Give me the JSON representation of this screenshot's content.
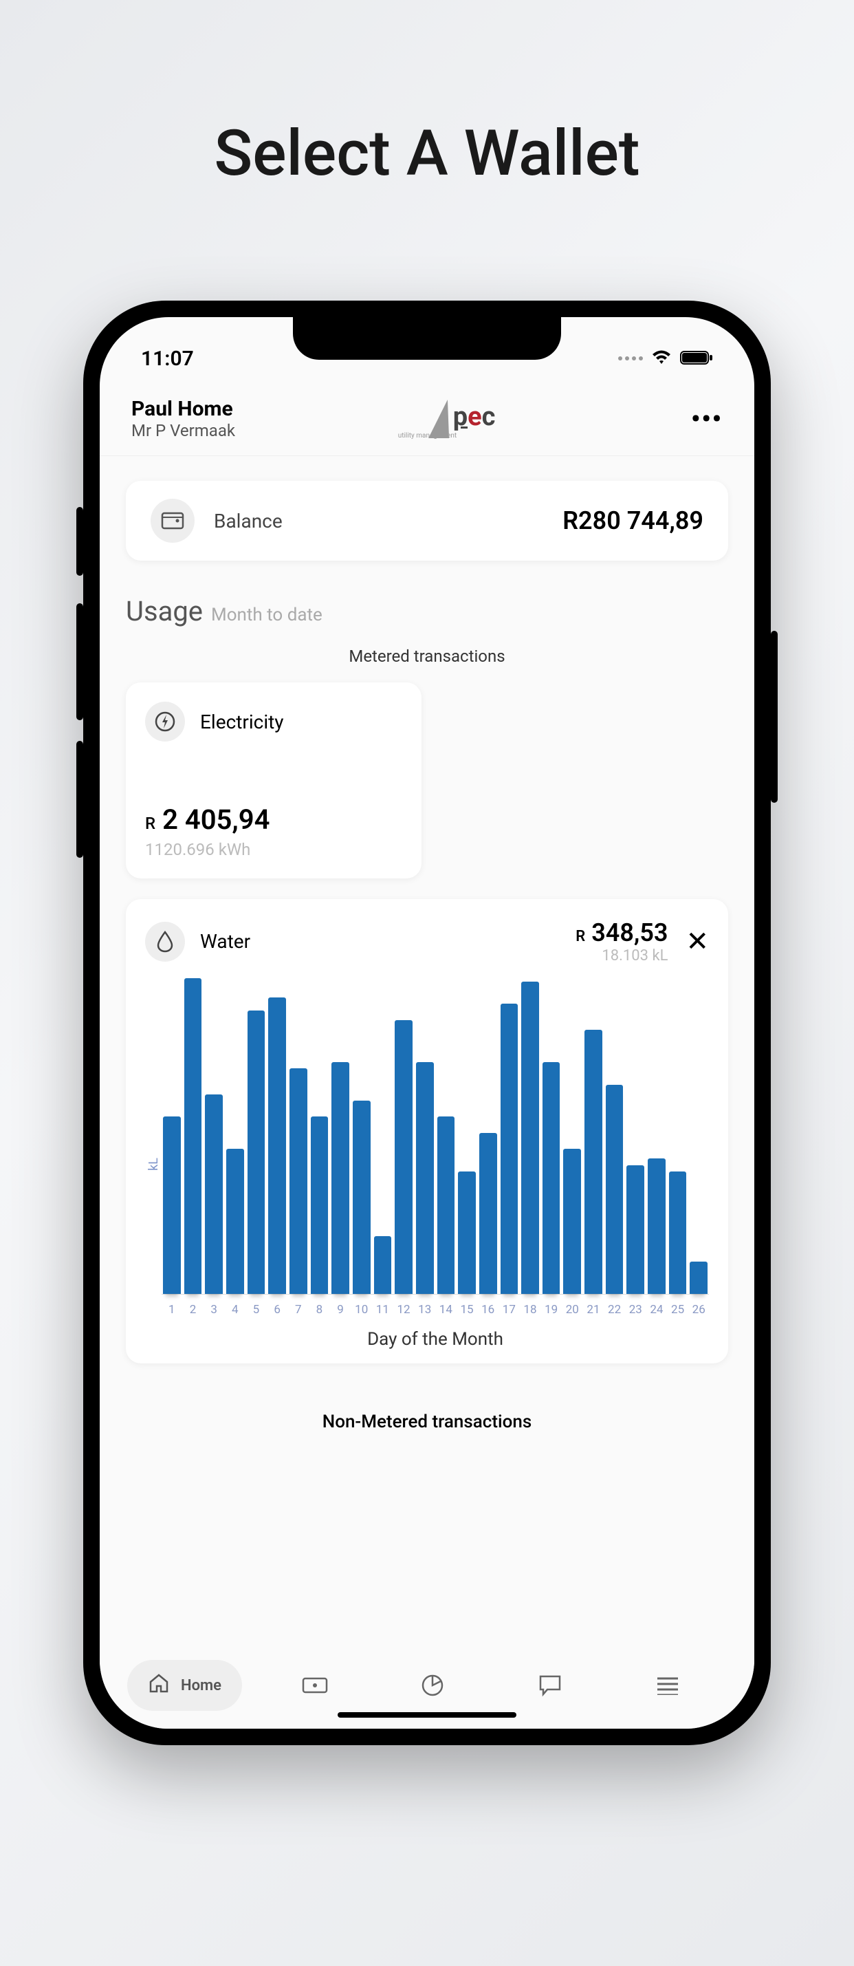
{
  "promo": {
    "title": "Select A Wallet"
  },
  "statusbar": {
    "time": "11:07"
  },
  "header": {
    "wallet_name": "Paul Home",
    "owner": "Mr P Vermaak",
    "logo_tag": "utility management"
  },
  "balance": {
    "label": "Balance",
    "amount": "R280 744,89"
  },
  "usage": {
    "title": "Usage",
    "subtitle": "Month to date",
    "section_label": "Metered transactions"
  },
  "electricity": {
    "label": "Electricity",
    "currency": "R",
    "amount": "2 405,94",
    "units": "1120.696 kWh"
  },
  "water": {
    "label": "Water",
    "currency": "R",
    "amount": "348,53",
    "units": "18.103 kL",
    "close": "✕",
    "ylabel": "kL",
    "xlabel": "Day of the Month"
  },
  "nonmetered": {
    "label": "Non-Metered transactions"
  },
  "nav": {
    "home": "Home"
  },
  "chart_data": {
    "type": "bar",
    "title": "Water",
    "ylabel": "kL",
    "xlabel": "Day of the Month",
    "categories": [
      1,
      2,
      3,
      4,
      5,
      6,
      7,
      8,
      9,
      10,
      11,
      12,
      13,
      14,
      15,
      16,
      17,
      18,
      19,
      20,
      21,
      22,
      23,
      24,
      25,
      26
    ],
    "values": [
      0.55,
      0.98,
      0.62,
      0.45,
      0.88,
      0.92,
      0.7,
      0.55,
      0.72,
      0.6,
      0.18,
      0.85,
      0.72,
      0.55,
      0.38,
      0.5,
      0.9,
      0.97,
      0.72,
      0.45,
      0.82,
      0.65,
      0.4,
      0.42,
      0.38,
      0.1
    ]
  }
}
